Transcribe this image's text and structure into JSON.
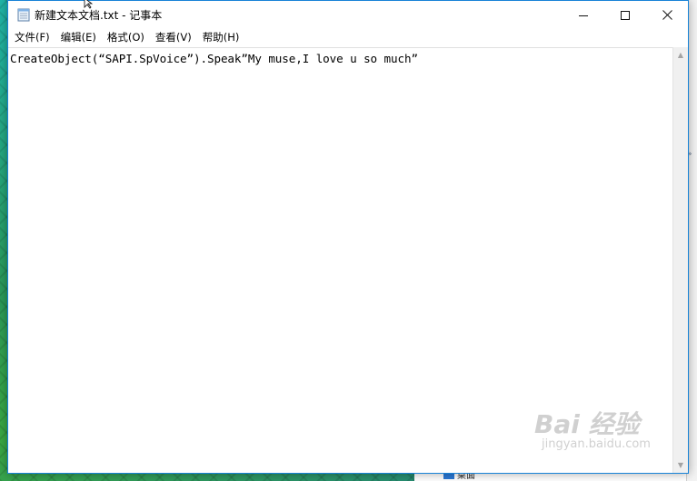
{
  "window": {
    "title": "新建文本文档.txt - 记事本",
    "accent_color": "#1883d7",
    "controls": {
      "minimize_icon": "minimize-icon",
      "maximize_icon": "maximize-icon",
      "close_icon": "close-icon"
    }
  },
  "menu": {
    "items": [
      {
        "label": "文件(F)"
      },
      {
        "label": "编辑(E)"
      },
      {
        "label": "格式(O)"
      },
      {
        "label": "查看(V)"
      },
      {
        "label": "帮助(H)"
      }
    ]
  },
  "editor": {
    "content": "CreateObject(“SAPI.SpVoice”).Speak”My muse,I love u so much”"
  },
  "background": {
    "taskbar_item": "桌面"
  },
  "watermark": {
    "main": "Bai 经验",
    "sub": "jingyan.baidu.com"
  }
}
